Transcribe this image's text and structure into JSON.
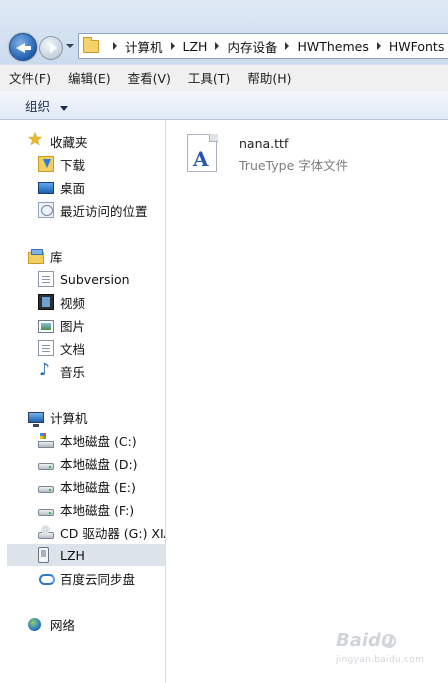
{
  "address_bar": {
    "breadcrumb": [
      "计算机",
      "LZH",
      "内存设备",
      "HWThemes",
      "HWFonts"
    ]
  },
  "menu": {
    "items": [
      "文件(F)",
      "编辑(E)",
      "查看(V)",
      "工具(T)",
      "帮助(H)"
    ]
  },
  "toolbar": {
    "organize_label": "组织"
  },
  "nav": {
    "favorites": {
      "label": "收藏夹",
      "items": [
        {
          "label": "下载",
          "icon": "download-folder-icon"
        },
        {
          "label": "桌面",
          "icon": "desktop-icon"
        },
        {
          "label": "最近访问的位置",
          "icon": "recent-places-icon"
        }
      ]
    },
    "libraries": {
      "label": "库",
      "items": [
        {
          "label": "Subversion",
          "icon": "document-icon"
        },
        {
          "label": "视频",
          "icon": "video-icon"
        },
        {
          "label": "图片",
          "icon": "picture-icon"
        },
        {
          "label": "文档",
          "icon": "document-icon"
        },
        {
          "label": "音乐",
          "icon": "music-icon"
        }
      ]
    },
    "computer": {
      "label": "计算机",
      "items": [
        {
          "label": "本地磁盘 (C:)",
          "icon": "windows-drive-icon"
        },
        {
          "label": "本地磁盘 (D:)",
          "icon": "drive-icon"
        },
        {
          "label": "本地磁盘 (E:)",
          "icon": "drive-icon"
        },
        {
          "label": "本地磁盘 (F:)",
          "icon": "drive-icon"
        },
        {
          "label": "CD 驱动器 (G:) XIA",
          "icon": "cd-drive-icon"
        },
        {
          "label": "LZH",
          "icon": "phone-device-icon",
          "selected": true
        },
        {
          "label": "百度云同步盘",
          "icon": "cloud-sync-icon"
        }
      ]
    },
    "network": {
      "label": "网络"
    }
  },
  "content": {
    "files": [
      {
        "name": "nana.ttf",
        "type": "TrueType 字体文件",
        "icon": "truetype-font-icon",
        "glyph": "A"
      }
    ]
  },
  "watermark": {
    "logo": "Baidu",
    "url": "jingyan.baidu.com"
  },
  "colors": {
    "selected_bg": "#dde3ea",
    "chrome_top": "#dfe9f5",
    "file_type_text": "#7d7d7d"
  }
}
